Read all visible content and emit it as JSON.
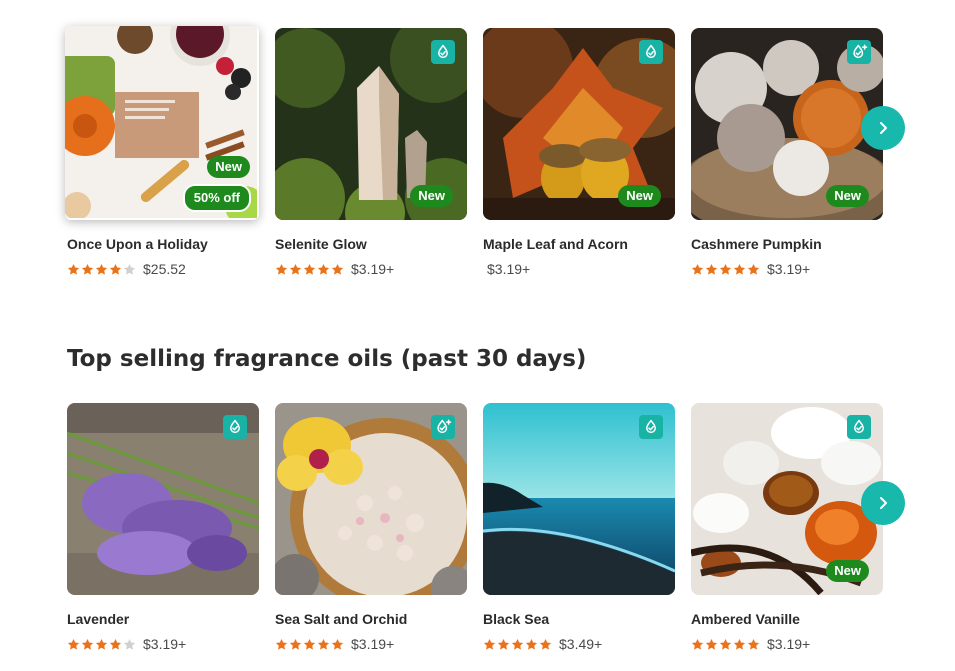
{
  "colors": {
    "accent": "#19b8ad",
    "badge": "#1e8a1e",
    "star": "#e8731a",
    "star_empty": "#d0d0d0"
  },
  "carousel_1": {
    "next_icon": "chevron-right-icon",
    "cards": [
      {
        "name": "Once Upon a Holiday",
        "rating": 4,
        "price": "$25.52",
        "badge": "New",
        "discount": "50% off",
        "show_stars": true
      },
      {
        "name": "Selenite Glow",
        "rating": 5,
        "price": "$3.19+",
        "badge": "New",
        "icon": "drop-check-icon",
        "show_stars": true
      },
      {
        "name": "Maple Leaf and Acorn",
        "price": "$3.19+",
        "badge": "New",
        "icon": "drop-check-icon",
        "show_stars": false
      },
      {
        "name": "Cashmere Pumpkin",
        "rating": 5,
        "price": "$3.19+",
        "badge": "New",
        "icon": "drop-plus-icon",
        "show_stars": true
      }
    ]
  },
  "section_2": {
    "title": "Top selling fragrance oils (past 30 days)",
    "next_icon": "chevron-right-icon",
    "cards": [
      {
        "name": "Lavender",
        "rating": 4,
        "price": "$3.19+",
        "icon": "drop-check-icon",
        "show_stars": true
      },
      {
        "name": "Sea Salt and Orchid",
        "rating": 5,
        "price": "$3.19+",
        "icon": "drop-plus-icon",
        "show_stars": true
      },
      {
        "name": "Black Sea",
        "rating": 5,
        "price": "$3.49+",
        "icon": "drop-check-icon",
        "show_stars": true
      },
      {
        "name": "Ambered Vanille",
        "rating": 5,
        "price": "$3.19+",
        "badge": "New",
        "icon": "drop-check-icon",
        "show_stars": true
      }
    ]
  }
}
